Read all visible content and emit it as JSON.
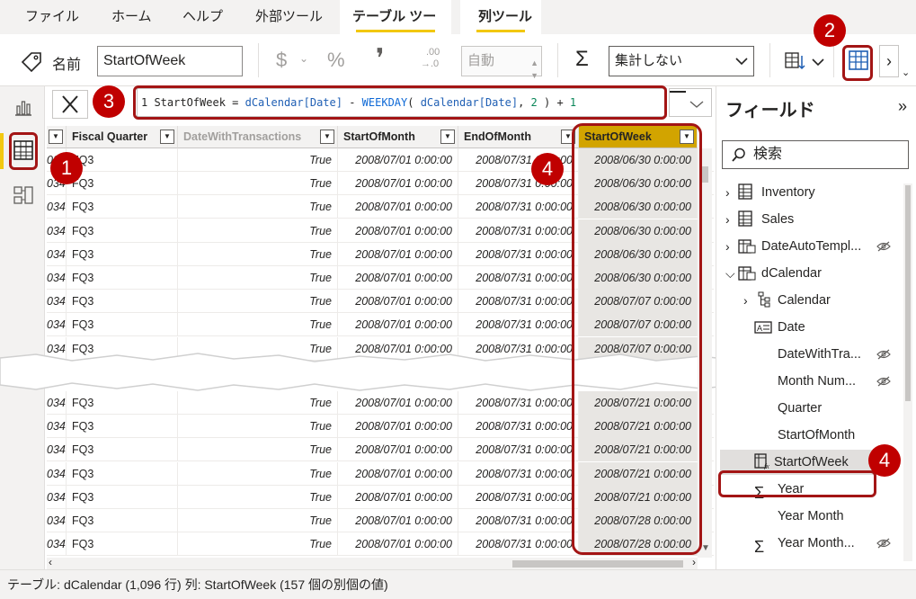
{
  "ribbon_tabs": [
    "ファイル",
    "ホーム",
    "ヘルプ",
    "外部ツール",
    "テーブル ツール",
    "列ツール"
  ],
  "ribbon": {
    "name_label": "名前",
    "name_value": "StartOfWeek",
    "currency_symbol": "$",
    "percent_symbol": "%",
    "comma_symbol": "❜",
    "decimal_top": ".00",
    "decimal_bottom": "→.0",
    "auto_value": "自動",
    "aggregation_value": "集計しない"
  },
  "formula": {
    "line": "1",
    "text_prefix": " StartOfWeek = ",
    "ref1": "dCalendar[Date]",
    "minus": " - ",
    "func": "WEEKDAY",
    "open": "( ",
    "ref2": "dCalendar[Date]",
    "comma": ", ",
    "arg": "2",
    "close": " ) + ",
    "plus": "1"
  },
  "table": {
    "headers": [
      "",
      "Fiscal Quarter",
      "DateWithTransactions",
      "StartOfMonth",
      "EndOfMonth",
      "StartOfWeek"
    ],
    "rows_top": [
      [
        "034",
        "FQ3",
        "True",
        "2008/07/01 0:00:00",
        "2008/07/31 0:00:00",
        "2008/06/30 0:00:00"
      ],
      [
        "034",
        "FQ3",
        "True",
        "2008/07/01 0:00:00",
        "2008/07/31 0:00:00",
        "2008/06/30 0:00:00"
      ],
      [
        "034",
        "FQ3",
        "True",
        "2008/07/01 0:00:00",
        "2008/07/31 0:00:00",
        "2008/06/30 0:00:00"
      ],
      [
        "034",
        "FQ3",
        "True",
        "2008/07/01 0:00:00",
        "2008/07/31 0:00:00",
        "2008/06/30 0:00:00"
      ],
      [
        "034",
        "FQ3",
        "True",
        "2008/07/01 0:00:00",
        "2008/07/31 0:00:00",
        "2008/06/30 0:00:00"
      ],
      [
        "034",
        "FQ3",
        "True",
        "2008/07/01 0:00:00",
        "2008/07/31 0:00:00",
        "2008/06/30 0:00:00"
      ],
      [
        "034",
        "FQ3",
        "True",
        "2008/07/01 0:00:00",
        "2008/07/31 0:00:00",
        "2008/07/07 0:00:00"
      ],
      [
        "034",
        "FQ3",
        "True",
        "2008/07/01 0:00:00",
        "2008/07/31 0:00:00",
        "2008/07/07 0:00:00"
      ],
      [
        "034",
        "FQ3",
        "True",
        "2008/07/01 0:00:00",
        "2008/07/31 0:00:00",
        "2008/07/07 0:00:00"
      ]
    ],
    "rows_bottom": [
      [
        "034",
        "FQ3",
        "True",
        "2008/07/01 0:00:00",
        "2008/07/31 0:00:00",
        "2008/07/21 0:00:00"
      ],
      [
        "034",
        "FQ3",
        "True",
        "2008/07/01 0:00:00",
        "2008/07/31 0:00:00",
        "2008/07/21 0:00:00"
      ],
      [
        "034",
        "FQ3",
        "True",
        "2008/07/01 0:00:00",
        "2008/07/31 0:00:00",
        "2008/07/21 0:00:00"
      ],
      [
        "034",
        "FQ3",
        "True",
        "2008/07/01 0:00:00",
        "2008/07/31 0:00:00",
        "2008/07/21 0:00:00"
      ],
      [
        "034",
        "FQ3",
        "True",
        "2008/07/01 0:00:00",
        "2008/07/31 0:00:00",
        "2008/07/21 0:00:00"
      ],
      [
        "034",
        "FQ3",
        "True",
        "2008/07/01 0:00:00",
        "2008/07/31 0:00:00",
        "2008/07/28 0:00:00"
      ],
      [
        "034",
        "FQ3",
        "True",
        "2008/07/01 0:00:00",
        "2008/07/31 0:00:00",
        "2008/07/28 0:00:00"
      ]
    ]
  },
  "fields_pane": {
    "title": "フィールド",
    "search_placeholder": "検索",
    "items": [
      {
        "label": "Inventory",
        "icon": "table-icon",
        "expand": "chevron-right"
      },
      {
        "label": "Sales",
        "icon": "table-icon",
        "expand": "chevron-right"
      },
      {
        "label": "DateAutoTempl...",
        "icon": "calendar-table-icon",
        "expand": "chevron-right",
        "hidden": true
      },
      {
        "label": "dCalendar",
        "icon": "calendar-table-icon",
        "expand": "chevron-down"
      },
      {
        "label": "Calendar",
        "icon": "hierarchy-icon",
        "expand": "chevron-right"
      },
      {
        "label": "Date",
        "icon": "date-field-icon"
      },
      {
        "label": "DateWithTra...",
        "icon": "",
        "hidden": true
      },
      {
        "label": "Month Num...",
        "icon": "",
        "hidden": true
      },
      {
        "label": "Quarter",
        "icon": ""
      },
      {
        "label": "StartOfMonth",
        "icon": ""
      },
      {
        "label": "StartOfWeek",
        "icon": "calculated-column-icon"
      },
      {
        "label": "Year",
        "icon": "sigma-icon"
      },
      {
        "label": "Year Month",
        "icon": ""
      },
      {
        "label": "Year Month...",
        "icon": "sigma-icon",
        "hidden": true
      }
    ]
  },
  "status_bar": "テーブル: dCalendar (1,096 行) 列: StartOfWeek (157 個の別個の値)",
  "callouts": [
    "1",
    "2",
    "3",
    "4",
    "4"
  ],
  "colors": {
    "accent": "#f2c811",
    "selected_header": "#d2a400",
    "callout": "#c00000",
    "highlight_border": "#a31515"
  }
}
